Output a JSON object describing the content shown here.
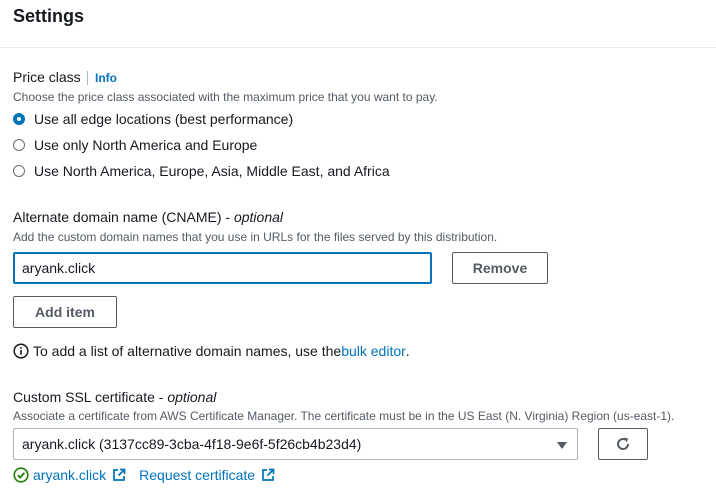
{
  "section": {
    "title": "Settings"
  },
  "price_class": {
    "label": "Price class",
    "info": "Info",
    "description": "Choose the price class associated with the maximum price that you want to pay.",
    "options": [
      {
        "label": "Use all edge locations (best performance)",
        "selected": true
      },
      {
        "label": "Use only North America and Europe",
        "selected": false
      },
      {
        "label": "Use North America, Europe, Asia, Middle East, and Africa",
        "selected": false
      }
    ]
  },
  "cname": {
    "label": "Alternate domain name (CNAME) - ",
    "optional": "optional",
    "description": "Add the custom domain names that you use in URLs for the files served by this distribution.",
    "value": "aryank.click",
    "remove_label": "Remove",
    "add_label": "Add item",
    "note_prefix": "To add a list of alternative domain names, use the ",
    "note_link": "bulk editor",
    "note_suffix": "."
  },
  "ssl": {
    "label": "Custom SSL certificate - ",
    "optional": "optional",
    "description": "Associate a certificate from AWS Certificate Manager. The certificate must be in the US East (N. Virginia) Region (us-east-1).",
    "selected": "aryank.click (3137cc89-3cba-4f18-9e6f-5f26cb4b23d4)",
    "status_link": "aryank.click",
    "request_link": "Request certificate"
  },
  "colors": {
    "accent": "#0073bb",
    "success": "#1d8102",
    "text": "#16191f",
    "muted": "#545b64"
  },
  "icons": [
    "info-circle-icon",
    "refresh-icon",
    "check-circle-icon",
    "external-link-icon",
    "caret-down-icon"
  ]
}
